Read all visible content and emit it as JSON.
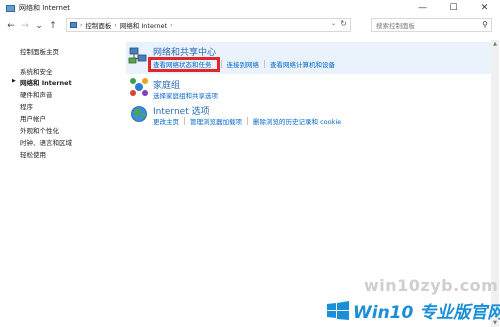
{
  "window": {
    "title": "网络和 Internet",
    "controls": {
      "minimize": "—",
      "maximize": "☐",
      "close": "✕"
    }
  },
  "nav": {
    "back": "←",
    "forward": "→",
    "recent": "⌄",
    "up": "↑",
    "breadcrumbs": [
      "控制面板",
      "网络和 Internet"
    ],
    "separator": "›",
    "dropdown": "⌄",
    "refresh": "↻",
    "search_placeholder": "搜索控制面板",
    "search_icon": "⚲"
  },
  "sidebar": {
    "items": [
      {
        "label": "控制面板主页",
        "current": false
      },
      {
        "label": "系统和安全",
        "current": false
      },
      {
        "label": "网络和 Internet",
        "current": true
      },
      {
        "label": "硬件和声音",
        "current": false
      },
      {
        "label": "程序",
        "current": false
      },
      {
        "label": "用户帐户",
        "current": false
      },
      {
        "label": "外观和个性化",
        "current": false
      },
      {
        "label": "时钟、语言和区域",
        "current": false
      },
      {
        "label": "轻松使用",
        "current": false
      }
    ],
    "current_marker": "▶"
  },
  "categories": [
    {
      "title": "网络和共享中心",
      "icon": "network-sharing-center-icon",
      "links": [
        "查看网络状态和任务",
        "连接到网络",
        "查看网络计算机和设备"
      ]
    },
    {
      "title": "家庭组",
      "icon": "homegroup-icon",
      "links": [
        "选择家庭组和共享选项"
      ]
    },
    {
      "title": "Internet 选项",
      "icon": "internet-options-icon",
      "links": [
        "更改主页",
        "管理浏览器加载项",
        "删除浏览的历史记录和 cookie"
      ]
    }
  ],
  "watermark": {
    "url": "win10zyb.com",
    "brand": "Win10 专业版官网"
  },
  "colors": {
    "link": "#0066cc",
    "category_title": "#2b6bb5",
    "highlight": "#eaf3fb",
    "annotation_red": "#e0272b",
    "watermark_blue": "#1a8ed6"
  },
  "scrollbar": {
    "up": "▲",
    "down": "▼"
  }
}
